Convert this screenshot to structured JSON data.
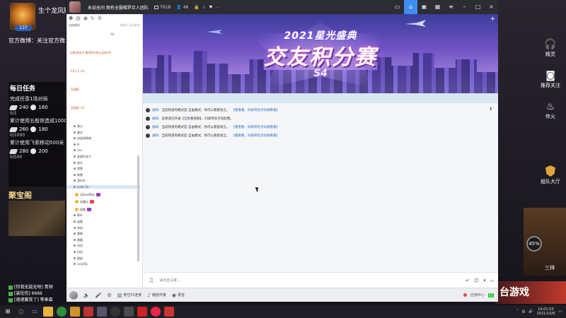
{
  "overlay": {
    "streamer_name": "生个龙凤胎",
    "level": "137",
    "weibo": "官方微博：关注官方微",
    "tasks": {
      "title": "每日任务",
      "rows": [
        {
          "text": "完成任意1场对局",
          "a": "240",
          "b": "160",
          "count": "0/1"
        },
        {
          "text": "累计使用五般铁造成1000点",
          "a": "260",
          "b": "180",
          "count": "0/1000"
        },
        {
          "text": "累计使用飞索移动500米",
          "a": "280",
          "b": "200",
          "count": "0/500"
        }
      ]
    },
    "jubao": "聚宝阁",
    "chat": [
      "[你我无敌无呀] 青铜",
      "[装忧伤] 6666",
      "[速速赢我了] 等奉森"
    ],
    "side": [
      {
        "label": "精灵",
        "icon": "headset-icon"
      },
      {
        "label": "推荐关注",
        "icon": "camera-icon"
      },
      {
        "label": "传火",
        "icon": "fire-icon"
      },
      {
        "label": "组队大厅",
        "icon": "shield-icon"
      }
    ],
    "percent": "45%",
    "sanpai": "三排",
    "game_text": "台游戏"
  },
  "titlebar": {
    "channel": "永劫无间 拥有全服梯罗巨人团队",
    "stat1": "7618",
    "stat2": "46"
  },
  "sidebar": {
    "mode": "自由模式",
    "invite": "所有人可以发言",
    "tree": [
      {
        "type": "num",
        "text": "(1)"
      },
      {
        "type": "ch",
        "text": "卡麦/房衣/小黄/黑车/禁止挂机(0)"
      },
      {
        "type": "ch",
        "text": "【天人】(4)"
      },
      {
        "type": "ch",
        "text": "【宝藏】"
      },
      {
        "type": "ch",
        "text": "【英雄】(1)"
      },
      {
        "type": "sub",
        "text": "黄沙"
      },
      {
        "type": "sub",
        "text": "墨文"
      },
      {
        "type": "sub",
        "text": "逍遥青情感"
      },
      {
        "type": "sub",
        "text": "lll"
      },
      {
        "type": "sub",
        "text": "xxx"
      },
      {
        "type": "sub",
        "text": "爱要的关平"
      },
      {
        "type": "sub",
        "text": "星羊"
      },
      {
        "type": "sub",
        "text": "猎野"
      },
      {
        "type": "sub",
        "text": "铁鼎"
      },
      {
        "type": "sub",
        "text": "游科羊"
      },
      {
        "type": "sel",
        "text": "Lolla (3)"
      },
      {
        "type": "user",
        "text": "12loveRos"
      },
      {
        "type": "user",
        "text": "初遇元"
      },
      {
        "type": "user",
        "text": "网瓶"
      },
      {
        "type": "sub",
        "text": "枫叶"
      },
      {
        "type": "sub",
        "text": "盗墓"
      },
      {
        "type": "sub",
        "text": "李档"
      },
      {
        "type": "sub",
        "text": "墨鲸"
      },
      {
        "type": "sub",
        "text": "墨墨"
      },
      {
        "type": "sub",
        "text": "初风"
      },
      {
        "type": "sub",
        "text": "风风"
      },
      {
        "type": "sub",
        "text": "檀韵"
      },
      {
        "type": "sub",
        "text": "1ss初风"
      }
    ]
  },
  "banner": {
    "line1": "2021星光盛典",
    "line2": "交友积分赛",
    "line3": "S4"
  },
  "messages": [
    {
      "label": "通知:",
      "text": "当前频道的模式是 自由模式，你可以随意发言。",
      "link": "【看看看、同骑带您点同骑看看】"
    },
    {
      "label": "通知:",
      "text": "这频道已开通【全民看视频】，同骑带您点同起哦。",
      "link": ""
    },
    {
      "label": "通知:",
      "text": "当前频道的模式是 自由模式，你可以随意发言。",
      "link": "【看看看、同骑带您点同骑看看】"
    },
    {
      "label": "通知:",
      "text": "当前频道的模式是 自由模式，你可以随意发言。",
      "link": "【看看看、同骑带您点同骑看看】"
    }
  ],
  "input": {
    "placeholder": "请点击以发..."
  },
  "bottombar": {
    "item1": "麦位F2连麦",
    "item2": "播放伴奏",
    "item3": "录音",
    "right1": "应用中心"
  },
  "taskbar": {
    "time": "14:01:03",
    "date": "2021/10/8"
  }
}
